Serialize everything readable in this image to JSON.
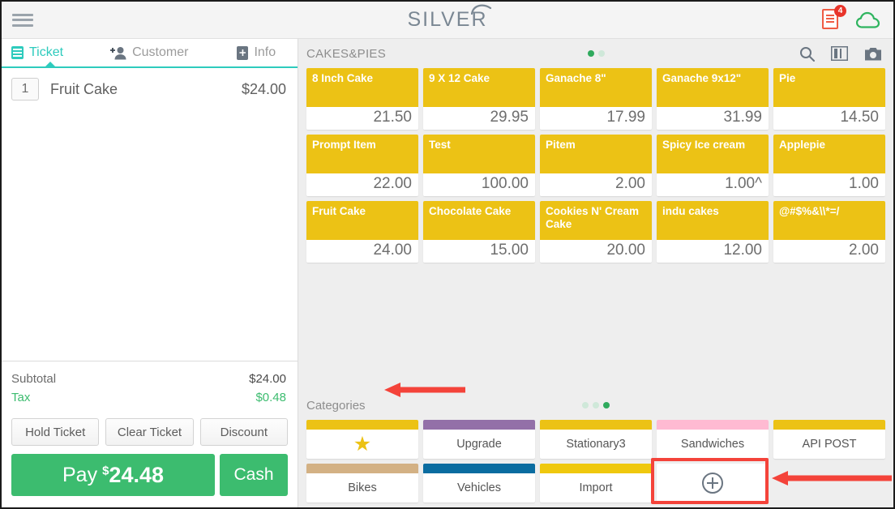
{
  "topbar": {
    "menu_icon": "hamburger-icon",
    "brand": "SILVER",
    "receipt_icon": "receipt-icon",
    "receipt_badge": "4",
    "cloud_icon": "cloud-icon"
  },
  "ticket_panel": {
    "tabs": [
      {
        "label": "Ticket",
        "icon": "ticket-icon",
        "active": true
      },
      {
        "label": "Customer",
        "icon": "add-person-icon",
        "active": false
      },
      {
        "label": "Info",
        "icon": "info-document-icon",
        "active": false
      }
    ],
    "items": [
      {
        "qty": "1",
        "name": "Fruit Cake",
        "price": "$24.00"
      }
    ],
    "totals": [
      {
        "label": "Subtotal",
        "value": "$24.00"
      },
      {
        "label": "Tax",
        "value": "$0.48"
      }
    ],
    "buttons": {
      "hold": "Hold Ticket",
      "clear": "Clear Ticket",
      "discount": "Discount",
      "pay_label": "Pay",
      "pay_currency": "$",
      "pay_amount": "24.48",
      "cash": "Cash"
    }
  },
  "products": {
    "title": "CAKES&PIES",
    "page_dots": 2,
    "active_dot": 1,
    "icons": [
      "search-icon",
      "layout-columns-icon",
      "camera-icon"
    ],
    "items": [
      {
        "name": "8 Inch Cake",
        "price": "21.50"
      },
      {
        "name": "9 X 12 Cake",
        "price": "29.95"
      },
      {
        "name": "Ganache 8\"",
        "price": "17.99"
      },
      {
        "name": "Ganache 9x12\"",
        "price": "31.99"
      },
      {
        "name": "Pie",
        "price": "14.50"
      },
      {
        "name": "Prompt Item",
        "price": "22.00"
      },
      {
        "name": "Test",
        "price": "100.00"
      },
      {
        "name": "Pitem",
        "price": "2.00"
      },
      {
        "name": "Spicy Ice cream",
        "price": "1.00^"
      },
      {
        "name": "Applepie",
        "price": "1.00"
      },
      {
        "name": "Fruit Cake",
        "price": "24.00"
      },
      {
        "name": "Chocolate Cake",
        "price": "15.00"
      },
      {
        "name": "Cookies N' Cream Cake",
        "price": "20.00"
      },
      {
        "name": "indu cakes",
        "price": "12.00"
      },
      {
        "name": "@#$%&\\\\*=/",
        "price": "2.00"
      }
    ]
  },
  "categories": {
    "title": "Categories",
    "page_dots": 3,
    "active_dot": 3,
    "items": [
      {
        "name": "",
        "color": "#ecc215",
        "icon": "star-icon"
      },
      {
        "name": "Upgrade",
        "color": "#9370a8"
      },
      {
        "name": "Stationary3",
        "color": "#ecc215"
      },
      {
        "name": "Sandwiches",
        "color": "#ffbad2"
      },
      {
        "name": "API POST",
        "color": "#ecc215"
      },
      {
        "name": "Bikes",
        "color": "#d3b184"
      },
      {
        "name": "Vehicles",
        "color": "#0a6ca0"
      },
      {
        "name": "Import",
        "color": "#efc80e"
      },
      {
        "name": "",
        "color": "#ffffff",
        "icon": "plus-circle-icon"
      }
    ]
  },
  "annotations": {
    "arrow_color": "#f4433a",
    "highlight_color": "#f4433a",
    "targets": [
      "categories-label",
      "add-category-button"
    ]
  },
  "colors": {
    "accent_teal": "#2ecbbd",
    "pay_green": "#3cbc6f",
    "tile_gold": "#ecc215",
    "slate": "#6a7581"
  }
}
